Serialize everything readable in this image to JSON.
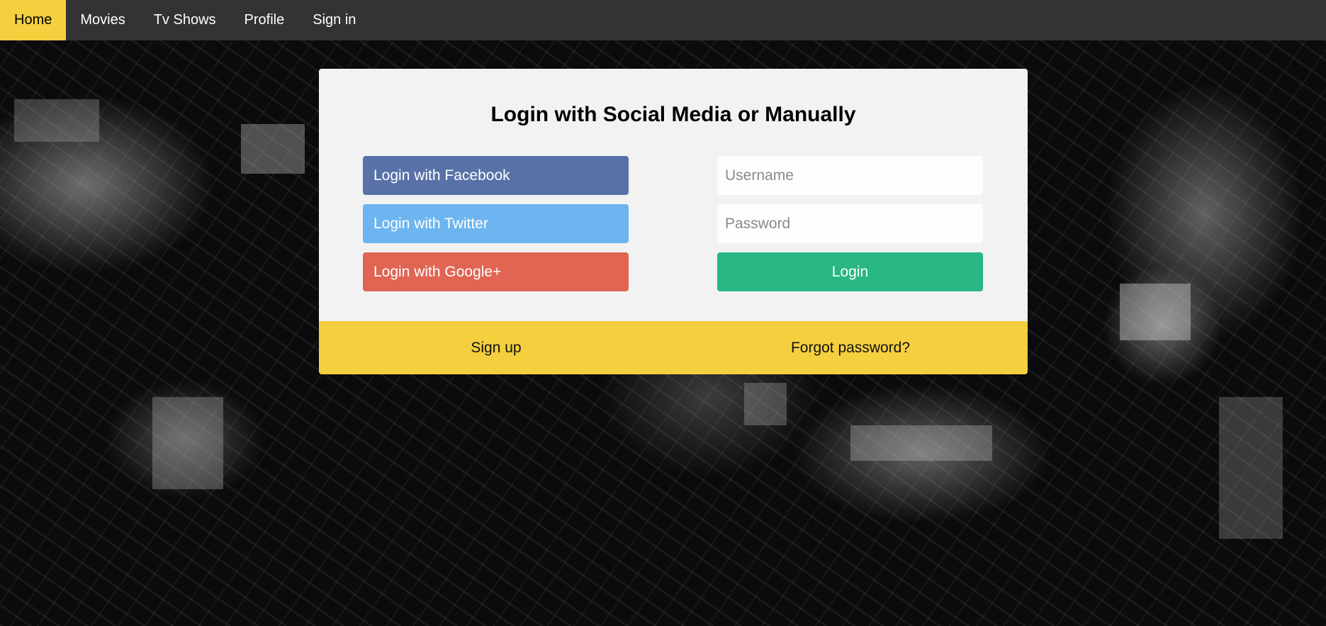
{
  "nav": {
    "items": [
      {
        "label": "Home",
        "active": true
      },
      {
        "label": "Movies",
        "active": false
      },
      {
        "label": "Tv Shows",
        "active": false
      },
      {
        "label": "Profile",
        "active": false
      },
      {
        "label": "Sign in",
        "active": false
      }
    ],
    "background_color": "#333333",
    "active_color": "#f4cf3e"
  },
  "login": {
    "title": "Login with Social Media or Manually",
    "social": [
      {
        "label": "Login with Facebook",
        "color": "#5872a8"
      },
      {
        "label": "Login with Twitter",
        "color": "#6cb5f0"
      },
      {
        "label": "Login with Google+",
        "color": "#e06553"
      }
    ],
    "username": {
      "value": "",
      "placeholder": "Username"
    },
    "password": {
      "value": "",
      "placeholder": "Password"
    },
    "submit": {
      "label": "Login",
      "color": "#29b783"
    }
  },
  "footer": {
    "signup_label": "Sign up",
    "forgot_label": "Forgot password?",
    "color": "#f4cf3e"
  }
}
